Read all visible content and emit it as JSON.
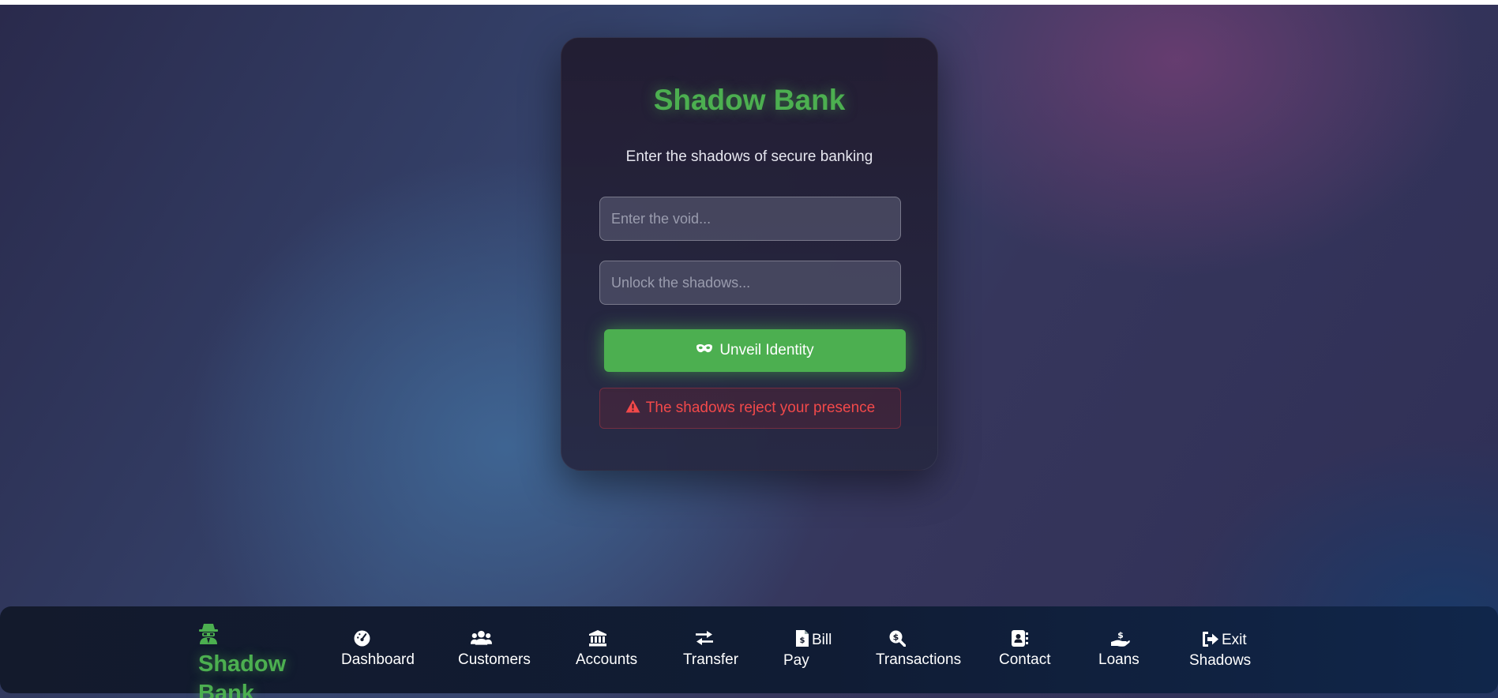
{
  "login": {
    "title": "Shadow Bank",
    "subtitle": "Enter the shadows of secure banking",
    "username_placeholder": "Enter the void...",
    "password_placeholder": "Unlock the shadows...",
    "submit_label": "Unveil Identity",
    "submit_icon": "mask-icon",
    "error_message": "The shadows reject your presence",
    "error_icon": "warning-icon"
  },
  "nav": {
    "brand_line1": "Shadow",
    "brand_line2": "Bank",
    "brand_icon": "spy-icon",
    "items": [
      {
        "line1": "",
        "line2": "Dashboard",
        "icon": "gauge-icon"
      },
      {
        "line1": "",
        "line2": "Customers",
        "icon": "users-icon"
      },
      {
        "line1": "",
        "line2": "Accounts",
        "icon": "bank-icon"
      },
      {
        "line1": "",
        "line2": "Transfer",
        "icon": "transfer-icon"
      },
      {
        "line1": "Bill",
        "line2": "Pay",
        "icon": "invoice-icon"
      },
      {
        "line1": "",
        "line2": "Transactions",
        "icon": "search-dollar-icon"
      },
      {
        "line1": "",
        "line2": "Contact",
        "icon": "address-book-icon"
      },
      {
        "line1": "",
        "line2": "Loans",
        "icon": "hand-holding-dollar-icon"
      },
      {
        "line1": "Exit",
        "line2": "Shadows",
        "icon": "sign-out-icon"
      }
    ]
  },
  "colors": {
    "accent": "#4caf50",
    "error": "#f2494a",
    "navbar": "#111a30"
  }
}
